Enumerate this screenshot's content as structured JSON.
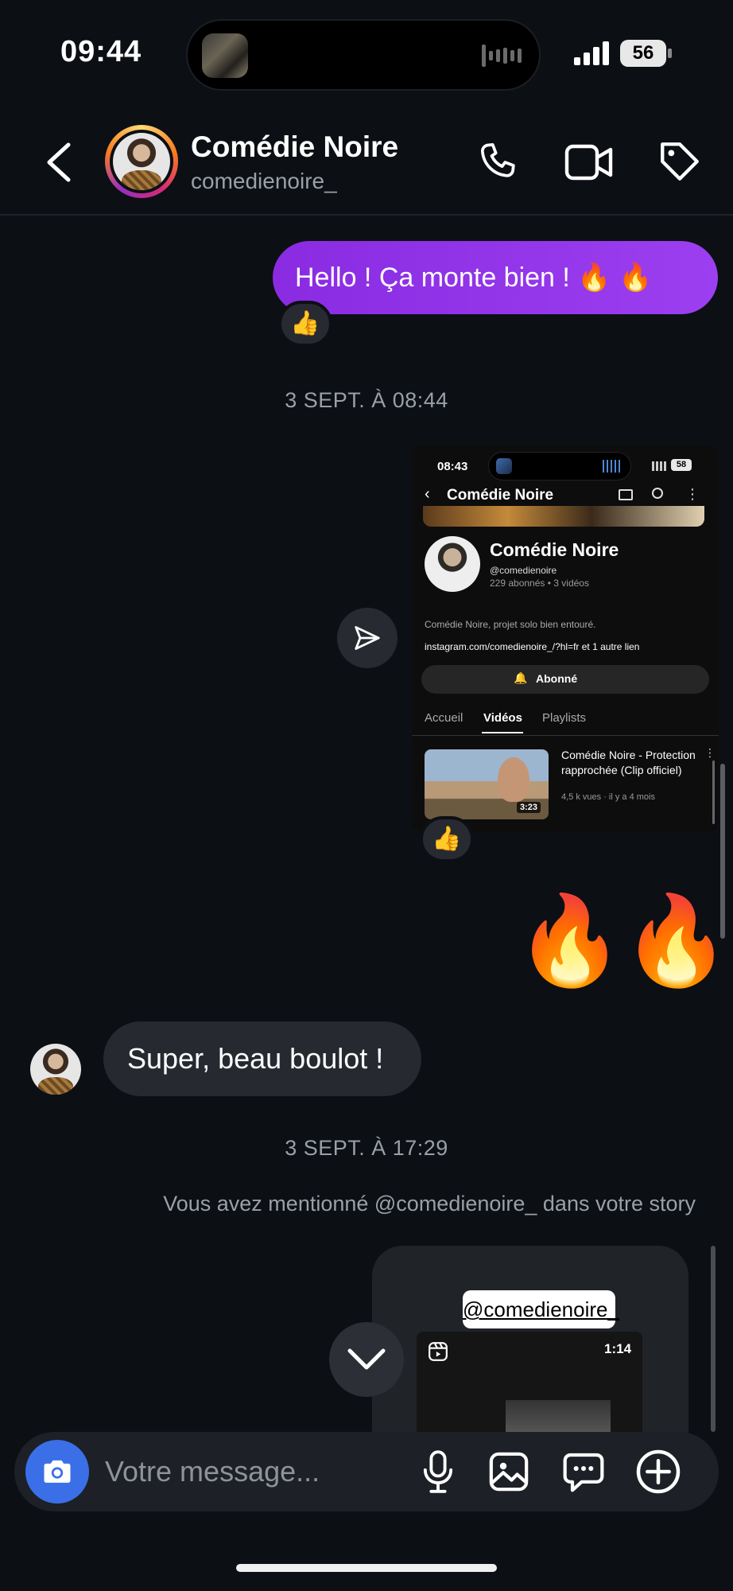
{
  "status_bar": {
    "time": "09:44",
    "battery": "56"
  },
  "header": {
    "name": "Comédie Noire",
    "handle": "comedienoire_"
  },
  "messages": {
    "outgoing_1": "Hello ! Ça monte bien ! 🔥 🔥",
    "reaction": "👍",
    "timestamp_1": "3 SEPT. À 08:44",
    "fire_1": "🔥",
    "fire_2": "🔥",
    "incoming_1": "Super, beau boulot !",
    "timestamp_2": "3 SEPT. À 17:29",
    "mention_notice": "Vous avez mentionné @comedienoire_ dans votre story",
    "story_tag": "@comedienoire_",
    "story_duration": "1:14"
  },
  "shared_screenshot": {
    "time": "08:43",
    "battery": "58",
    "title": "Comédie Noire",
    "channel_name": "Comédie Noire",
    "channel_handle": "@comedienoire",
    "channel_stats": "229 abonnés • 3 vidéos",
    "description": "Comédie Noire, projet solo bien entouré.",
    "link": "instagram.com/comedienoire_/?hl=fr et 1 autre lien",
    "subscribe_label": "Abonné",
    "tabs": [
      "Accueil",
      "Vidéos",
      "Playlists"
    ],
    "active_tab": "Vidéos",
    "video": {
      "title": "Comédie Noire - Protection rapprochée (Clip officiel)",
      "meta": "4,5 k vues · il y a 4 mois",
      "duration": "3:23"
    }
  },
  "composer": {
    "placeholder": "Votre message..."
  }
}
